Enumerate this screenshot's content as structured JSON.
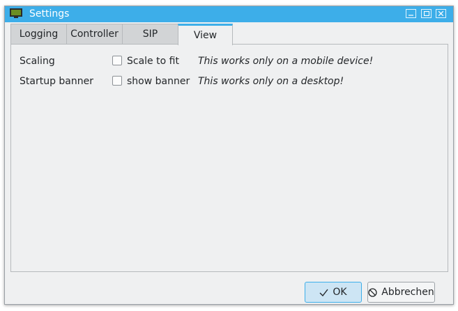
{
  "window": {
    "title": "Settings"
  },
  "tabs": [
    {
      "label": "Logging"
    },
    {
      "label": "Controller"
    },
    {
      "label": "SIP"
    },
    {
      "label": "View"
    }
  ],
  "active_tab": "View",
  "view": {
    "scaling": {
      "label": "Scaling",
      "checkbox_label": "Scale to fit",
      "checked": false,
      "note": "This works only on a mobile device!"
    },
    "startup_banner": {
      "label": "Startup banner",
      "checkbox_label": "show banner",
      "checked": false,
      "note": "This works only on a desktop!"
    }
  },
  "buttons": {
    "ok": "OK",
    "cancel": "Abbrechen"
  },
  "colors": {
    "accent": "#3daee9",
    "background": "#eff0f1"
  }
}
